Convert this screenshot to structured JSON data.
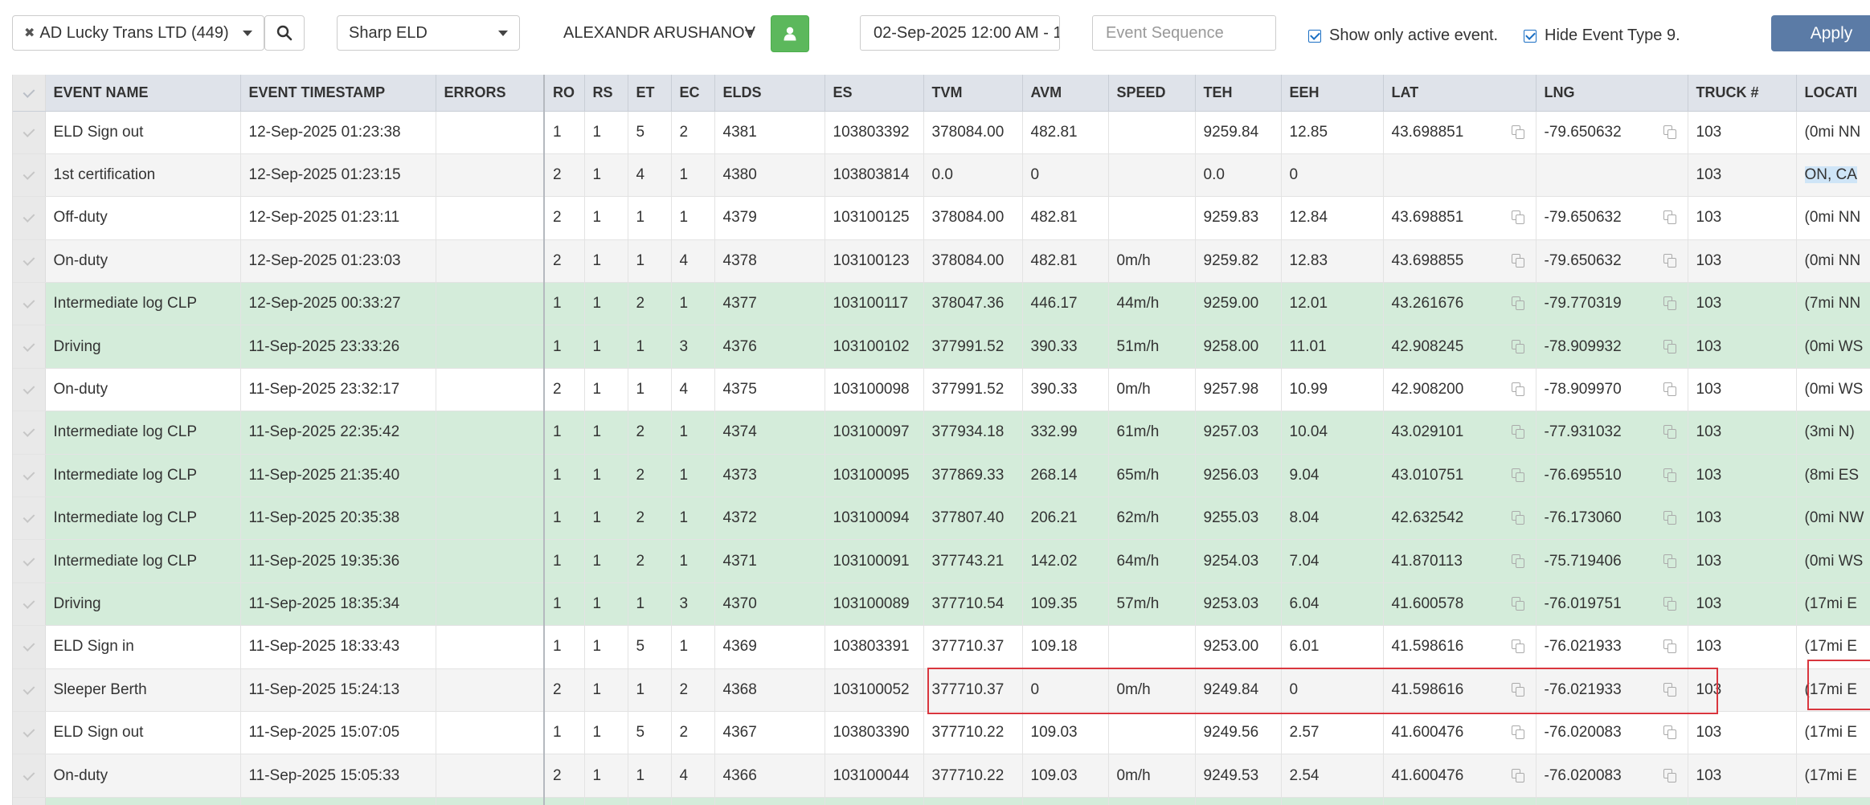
{
  "toolbar": {
    "company": {
      "clear_glyph": "✖",
      "label": "AD Lucky Trans LTD (449)"
    },
    "provider": "Sharp ELD",
    "driver": "ALEXANDR ARUSHANOV",
    "date_value": "02-Sep-2025 12:00 AM - 1",
    "event_sequence_placeholder": "Event Sequence",
    "show_active_label": "Show only active event.",
    "hide_type9_label": "Hide Event Type 9.",
    "apply_label": "Apply",
    "accent_green": "#5cb85c",
    "apply_color": "#5b7ba6"
  },
  "columns": [
    "EVENT NAME",
    "EVENT TIMESTAMP",
    "ERRORS",
    "RO",
    "RS",
    "ET",
    "EC",
    "ELDS",
    "ES",
    "TVM",
    "AVM",
    "SPEED",
    "TEH",
    "EEH",
    "LAT",
    "LNG",
    "TRUCK #",
    "LOCATI"
  ],
  "rows": [
    {
      "style": "white",
      "cells": [
        "ELD Sign out",
        "12-Sep-2025 01:23:38",
        "",
        "1",
        "1",
        "5",
        "2",
        "4381",
        "103803392",
        "378084.00",
        "482.81",
        "",
        "9259.84",
        "12.85",
        "43.698851",
        "-79.650632",
        "103",
        "(0mi NN"
      ]
    },
    {
      "style": "grey",
      "cells": [
        "1st certification",
        "12-Sep-2025 01:23:15",
        "",
        "2",
        "1",
        "4",
        "1",
        "4380",
        "103803814",
        "0.0",
        "0",
        "",
        "0.0",
        "0",
        "",
        "",
        "103",
        "ON, CA"
      ]
    },
    {
      "style": "white",
      "cells": [
        "Off-duty",
        "12-Sep-2025 01:23:11",
        "",
        "2",
        "1",
        "1",
        "1",
        "4379",
        "103100125",
        "378084.00",
        "482.81",
        "",
        "9259.83",
        "12.84",
        "43.698851",
        "-79.650632",
        "103",
        "(0mi NN"
      ]
    },
    {
      "style": "grey",
      "cells": [
        "On-duty",
        "12-Sep-2025 01:23:03",
        "",
        "2",
        "1",
        "1",
        "4",
        "4378",
        "103100123",
        "378084.00",
        "482.81",
        "0m/h",
        "9259.82",
        "12.83",
        "43.698855",
        "-79.650632",
        "103",
        "(0mi NN"
      ]
    },
    {
      "style": "green",
      "cells": [
        "Intermediate log CLP",
        "12-Sep-2025 00:33:27",
        "",
        "1",
        "1",
        "2",
        "1",
        "4377",
        "103100117",
        "378047.36",
        "446.17",
        "44m/h",
        "9259.00",
        "12.01",
        "43.261676",
        "-79.770319",
        "103",
        "(7mi NN"
      ]
    },
    {
      "style": "green",
      "cells": [
        "Driving",
        "11-Sep-2025 23:33:26",
        "",
        "1",
        "1",
        "1",
        "3",
        "4376",
        "103100102",
        "377991.52",
        "390.33",
        "51m/h",
        "9258.00",
        "11.01",
        "42.908245",
        "-78.909932",
        "103",
        "(0mi WS"
      ]
    },
    {
      "style": "white",
      "cells": [
        "On-duty",
        "11-Sep-2025 23:32:17",
        "",
        "2",
        "1",
        "1",
        "4",
        "4375",
        "103100098",
        "377991.52",
        "390.33",
        "0m/h",
        "9257.98",
        "10.99",
        "42.908200",
        "-78.909970",
        "103",
        "(0mi WS"
      ]
    },
    {
      "style": "green",
      "cells": [
        "Intermediate log CLP",
        "11-Sep-2025 22:35:42",
        "",
        "1",
        "1",
        "2",
        "1",
        "4374",
        "103100097",
        "377934.18",
        "332.99",
        "61m/h",
        "9257.03",
        "10.04",
        "43.029101",
        "-77.931032",
        "103",
        "(3mi N)"
      ]
    },
    {
      "style": "green",
      "cells": [
        "Intermediate log CLP",
        "11-Sep-2025 21:35:40",
        "",
        "1",
        "1",
        "2",
        "1",
        "4373",
        "103100095",
        "377869.33",
        "268.14",
        "65m/h",
        "9256.03",
        "9.04",
        "43.010751",
        "-76.695510",
        "103",
        "(8mi ES"
      ]
    },
    {
      "style": "green",
      "cells": [
        "Intermediate log CLP",
        "11-Sep-2025 20:35:38",
        "",
        "1",
        "1",
        "2",
        "1",
        "4372",
        "103100094",
        "377807.40",
        "206.21",
        "62m/h",
        "9255.03",
        "8.04",
        "42.632542",
        "-76.173060",
        "103",
        "(0mi NW"
      ]
    },
    {
      "style": "green",
      "cells": [
        "Intermediate log CLP",
        "11-Sep-2025 19:35:36",
        "",
        "1",
        "1",
        "2",
        "1",
        "4371",
        "103100091",
        "377743.21",
        "142.02",
        "64m/h",
        "9254.03",
        "7.04",
        "41.870113",
        "-75.719406",
        "103",
        "(0mi WS"
      ]
    },
    {
      "style": "green",
      "cells": [
        "Driving",
        "11-Sep-2025 18:35:34",
        "",
        "1",
        "1",
        "1",
        "3",
        "4370",
        "103100089",
        "377710.54",
        "109.35",
        "57m/h",
        "9253.03",
        "6.04",
        "41.600578",
        "-76.019751",
        "103",
        "(17mi E"
      ]
    },
    {
      "style": "white",
      "cells": [
        "ELD Sign in",
        "11-Sep-2025 18:33:43",
        "",
        "1",
        "1",
        "5",
        "1",
        "4369",
        "103803391",
        "377710.37",
        "109.18",
        "",
        "9253.00",
        "6.01",
        "41.598616",
        "-76.021933",
        "103",
        "(17mi E"
      ]
    },
    {
      "style": "grey",
      "cells": [
        "Sleeper Berth",
        "11-Sep-2025 15:24:13",
        "",
        "2",
        "1",
        "1",
        "2",
        "4368",
        "103100052",
        "377710.37",
        "0",
        "0m/h",
        "9249.84",
        "0",
        "41.598616",
        "-76.021933",
        "103",
        "(17mi E"
      ]
    },
    {
      "style": "white",
      "cells": [
        "ELD Sign out",
        "11-Sep-2025 15:07:05",
        "",
        "1",
        "1",
        "5",
        "2",
        "4367",
        "103803390",
        "377710.22",
        "109.03",
        "",
        "9249.56",
        "2.57",
        "41.600476",
        "-76.020083",
        "103",
        "(17mi E"
      ]
    },
    {
      "style": "grey",
      "cells": [
        "On-duty",
        "11-Sep-2025 15:05:33",
        "",
        "2",
        "1",
        "1",
        "4",
        "4366",
        "103100044",
        "377710.22",
        "109.03",
        "0m/h",
        "9249.53",
        "2.54",
        "41.600476",
        "-76.020083",
        "103",
        "(17mi E"
      ]
    },
    {
      "style": "green",
      "cells": [
        "",
        "",
        "",
        "",
        "",
        "",
        "",
        "",
        "",
        "",
        "",
        "",
        "",
        "",
        "",
        "",
        "",
        ""
      ]
    }
  ],
  "highlight_color": "#d9363e"
}
